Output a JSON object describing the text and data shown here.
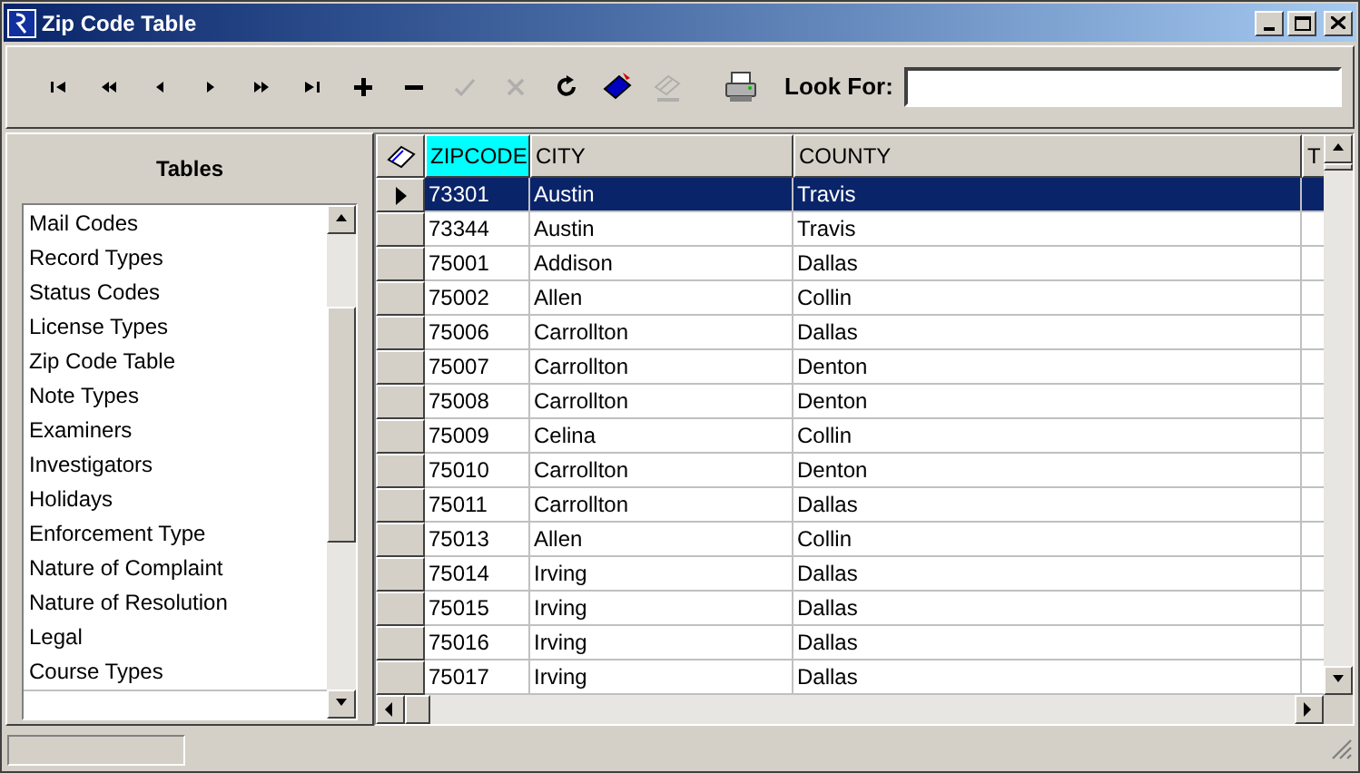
{
  "window": {
    "title": "Zip Code Table"
  },
  "toolbar": {
    "buttons": [
      {
        "kind": "first",
        "disabled": false
      },
      {
        "kind": "prior-page",
        "disabled": false
      },
      {
        "kind": "prior",
        "disabled": false
      },
      {
        "kind": "next",
        "disabled": false
      },
      {
        "kind": "next-page",
        "disabled": false
      },
      {
        "kind": "last",
        "disabled": false
      },
      {
        "kind": "insert",
        "disabled": false
      },
      {
        "kind": "delete",
        "disabled": false
      },
      {
        "kind": "post",
        "disabled": true
      },
      {
        "kind": "cancel",
        "disabled": true
      },
      {
        "kind": "refresh",
        "disabled": false
      },
      {
        "kind": "book",
        "disabled": false
      },
      {
        "kind": "goto",
        "disabled": true
      },
      {
        "kind": "print",
        "disabled": false
      }
    ],
    "look_for": {
      "label": "Look For:"
    }
  },
  "sidebar": {
    "title": "Tables",
    "items": [
      "Mail Codes",
      "Record Types",
      "Status Codes",
      "License Types",
      "Zip Code Table",
      "Note Types",
      "Examiners",
      "Investigators",
      "Holidays",
      "Enforcement Type",
      "Nature of Complaint",
      "Nature of Resolution",
      "Legal",
      "Course Types"
    ]
  },
  "table": {
    "columns": [
      {
        "label": "ZIPCODE",
        "selected": true
      },
      {
        "label": "CITY",
        "selected": false
      },
      {
        "label": "COUNTY",
        "selected": false
      },
      {
        "label": "T",
        "selected": false
      }
    ],
    "rows": [
      {
        "cells": [
          "73301",
          "Austin",
          "Travis"
        ],
        "selected": true
      },
      {
        "cells": [
          "73344",
          "Austin",
          "Travis"
        ],
        "selected": false
      },
      {
        "cells": [
          "75001",
          "Addison",
          "Dallas"
        ],
        "selected": false
      },
      {
        "cells": [
          "75002",
          "Allen",
          "Collin"
        ],
        "selected": false
      },
      {
        "cells": [
          "75006",
          "Carrollton",
          "Dallas"
        ],
        "selected": false
      },
      {
        "cells": [
          "75007",
          "Carrollton",
          "Denton"
        ],
        "selected": false
      },
      {
        "cells": [
          "75008",
          "Carrollton",
          "Denton"
        ],
        "selected": false
      },
      {
        "cells": [
          "75009",
          "Celina",
          "Collin"
        ],
        "selected": false
      },
      {
        "cells": [
          "75010",
          "Carrollton",
          "Denton"
        ],
        "selected": false
      },
      {
        "cells": [
          "75011",
          "Carrollton",
          "Dallas"
        ],
        "selected": false
      },
      {
        "cells": [
          "75013",
          "Allen",
          "Collin"
        ],
        "selected": false
      },
      {
        "cells": [
          "75014",
          "Irving",
          "Dallas"
        ],
        "selected": false
      },
      {
        "cells": [
          "75015",
          "Irving",
          "Dallas"
        ],
        "selected": false
      },
      {
        "cells": [
          "75016",
          "Irving",
          "Dallas"
        ],
        "selected": false
      },
      {
        "cells": [
          "75017",
          "Irving",
          "Dallas"
        ],
        "selected": false
      }
    ]
  }
}
